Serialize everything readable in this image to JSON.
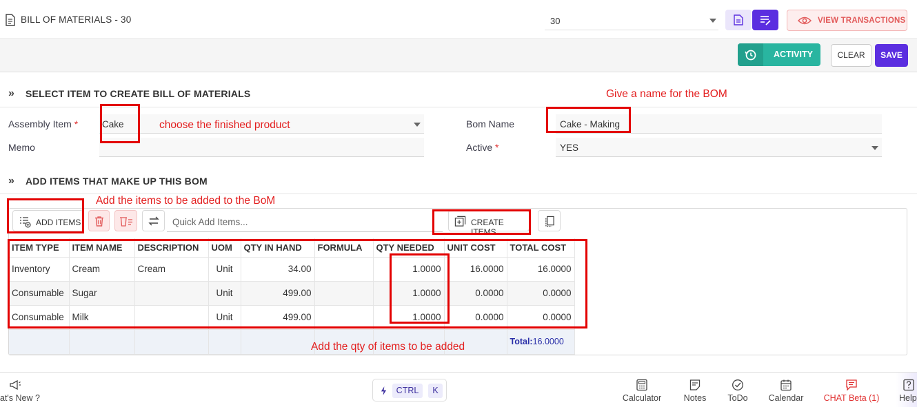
{
  "header": {
    "title": "BILL OF MATERIALS - 30",
    "record_value": "30",
    "view_transactions_label": "VIEW TRANSACTIONS"
  },
  "actions": {
    "activity_label": "ACTIVITY",
    "clear_label": "CLEAR",
    "save_label": "SAVE"
  },
  "section_select": {
    "title": "SELECT ITEM TO CREATE BILL OF MATERIALS",
    "assembly_item_label": "Assembly Item",
    "assembly_item_value": "Cake",
    "memo_label": "Memo",
    "memo_value": "",
    "bom_name_label": "Bom Name",
    "bom_name_value": "Cake - Making",
    "active_label": "Active",
    "active_value": "YES",
    "required_mark": "*"
  },
  "section_items": {
    "title": "ADD ITEMS THAT MAKE UP THIS BOM",
    "add_items_label": "ADD ITEMS",
    "quick_add_placeholder": "Quick Add Items...",
    "create_items_label": "CREATE ITEMS"
  },
  "table": {
    "columns": [
      "ITEM TYPE",
      "ITEM NAME",
      "DESCRIPTION",
      "UOM",
      "QTY IN HAND",
      "FORMULA",
      "QTY NEEDED",
      "UNIT COST",
      "TOTAL COST"
    ],
    "rows": [
      [
        "Inventory",
        "Cream",
        "Cream",
        "Unit",
        "34.00",
        "",
        "1.0000",
        "16.0000",
        "16.0000"
      ],
      [
        "Consumable",
        "Sugar",
        "",
        "Unit",
        "499.00",
        "",
        "1.0000",
        "0.0000",
        "0.0000"
      ],
      [
        "Consumable",
        "Milk",
        "",
        "Unit",
        "499.00",
        "",
        "1.0000",
        "0.0000",
        "0.0000"
      ]
    ],
    "total_label": "Total:",
    "total_value": "16.0000"
  },
  "annotations": {
    "choose_product": "choose the finished product",
    "give_name": "Give a name for the BOM",
    "add_items": "Add the items to be added to the BoM",
    "add_qty": "Add the qty of items to be added"
  },
  "bottombar": {
    "whats_new": "at's New ?",
    "ctrl_label": "CTRL",
    "k_label": "K",
    "calculator": "Calculator",
    "notes": "Notes",
    "todo": "ToDo",
    "calendar": "Calendar",
    "chat": "CHAT Beta (1)",
    "help": "Help"
  },
  "colors": {
    "accent_purple": "#5b2ee0",
    "activity_teal": "#29b5a0",
    "annotation_red": "#e30000",
    "danger_red": "#e25a5a"
  }
}
